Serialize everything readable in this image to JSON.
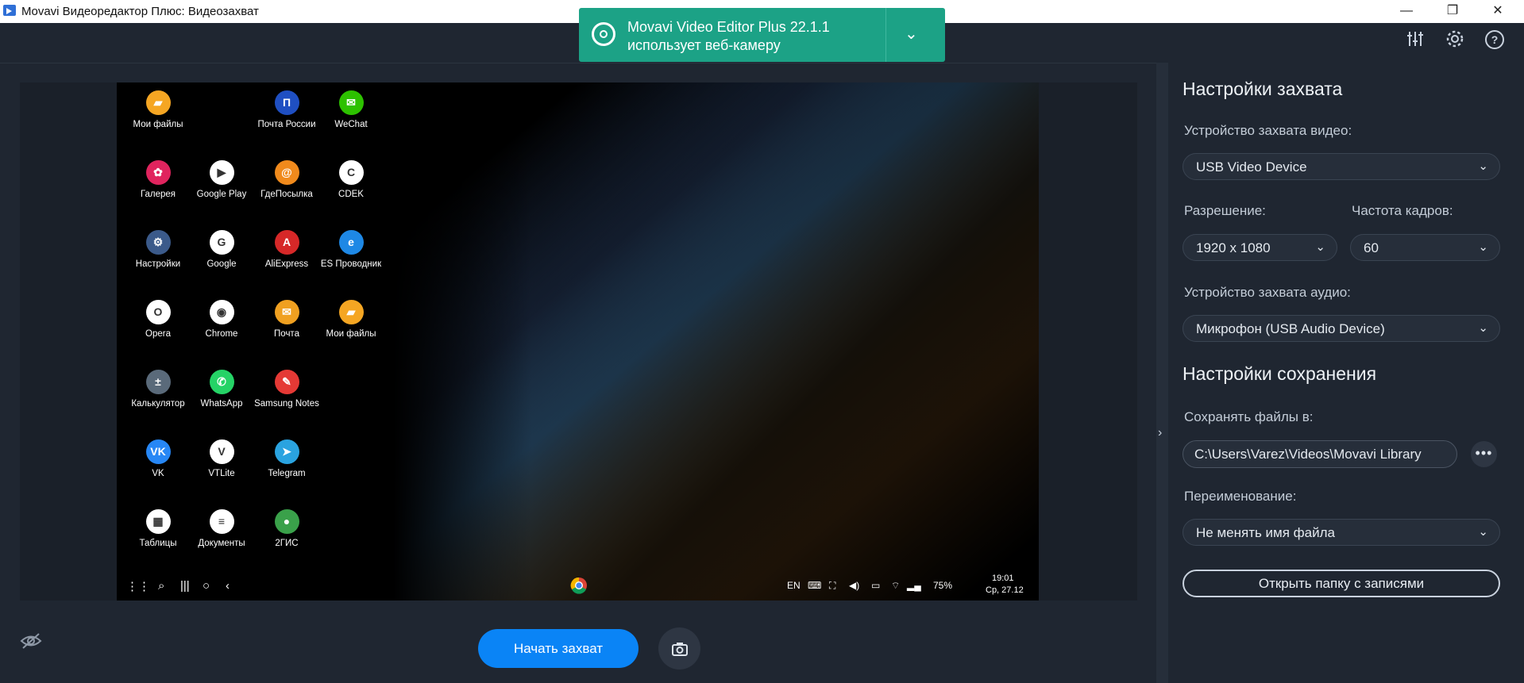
{
  "window": {
    "title": "Movavi Видеоредактор Плюс: Видеозахват",
    "minimize": "—",
    "maximize": "❐",
    "close": "✕"
  },
  "toolbar": {
    "icons": [
      "sliders-icon",
      "gear-icon",
      "help-icon"
    ]
  },
  "notification": {
    "line1": "Movavi Video Editor Plus 22.1.1",
    "line2": "использует веб-камеру"
  },
  "phone": {
    "apps": [
      {
        "label": "Мои файлы",
        "color": "#f5a623",
        "glyph": "▰"
      },
      {
        "label": "Почта России",
        "color": "#1f4fc2",
        "glyph": "П"
      },
      {
        "label": "WeChat",
        "color": "#2dc100",
        "glyph": "✉"
      },
      {
        "label": "Галерея",
        "color": "#e0245e",
        "glyph": "✿"
      },
      {
        "label": "Google Play",
        "color": "#ffffff",
        "glyph": "▶"
      },
      {
        "label": "ГдеПосылка",
        "color": "#f08a1c",
        "glyph": "@"
      },
      {
        "label": "CDEK",
        "color": "#ffffff",
        "glyph": "C"
      },
      {
        "label": "Настройки",
        "color": "#3b5a8a",
        "glyph": "⚙"
      },
      {
        "label": "Google",
        "color": "#ffffff",
        "glyph": "G"
      },
      {
        "label": "AliExpress",
        "color": "#d62828",
        "glyph": "A"
      },
      {
        "label": "ES Проводник",
        "color": "#1e88e5",
        "glyph": "e"
      },
      {
        "label": "Opera",
        "color": "#ffffff",
        "glyph": "O"
      },
      {
        "label": "Chrome",
        "color": "#ffffff",
        "glyph": "◉"
      },
      {
        "label": "Почта",
        "color": "#f0a020",
        "glyph": "✉"
      },
      {
        "label": "Мои файлы",
        "color": "#f5a623",
        "glyph": "▰"
      },
      {
        "label": "Калькулятор",
        "color": "#5a6a7a",
        "glyph": "±"
      },
      {
        "label": "WhatsApp",
        "color": "#25d366",
        "glyph": "✆"
      },
      {
        "label": "Samsung Notes",
        "color": "#e53935",
        "glyph": "✎"
      },
      {
        "label": "VK",
        "color": "#2787f5",
        "glyph": "VK"
      },
      {
        "label": "VTLite",
        "color": "#ffffff",
        "glyph": "V"
      },
      {
        "label": "Telegram",
        "color": "#2aa3e0",
        "glyph": "➤"
      },
      {
        "label": "Таблицы",
        "color": "#ffffff",
        "glyph": "▦"
      },
      {
        "label": "Документы",
        "color": "#ffffff",
        "glyph": "≡"
      },
      {
        "label": "2ГИС",
        "color": "#3aa14a",
        "glyph": "●"
      }
    ],
    "status": {
      "lang": "EN",
      "battery": "75%",
      "time": "19:01",
      "date": "Ср, 27.12"
    }
  },
  "capture": {
    "start_label": "Начать захват"
  },
  "settings": {
    "capture_title": "Настройки захвата",
    "video_device_label": "Устройство захвата видео:",
    "video_device_value": "USB Video Device",
    "resolution_label": "Разрешение:",
    "resolution_value": "1920 x 1080",
    "framerate_label": "Частота кадров:",
    "framerate_value": "60",
    "audio_device_label": "Устройство захвата аудио:",
    "audio_device_value": "Микрофон (USB Audio Device)",
    "save_title": "Настройки сохранения",
    "save_to_label": "Сохранять файлы в:",
    "save_path": "C:\\Users\\Varez\\Videos\\Movavi Library",
    "rename_label": "Переименование:",
    "rename_value": "Не менять имя файла",
    "open_folder_label": "Открыть папку с записями"
  }
}
